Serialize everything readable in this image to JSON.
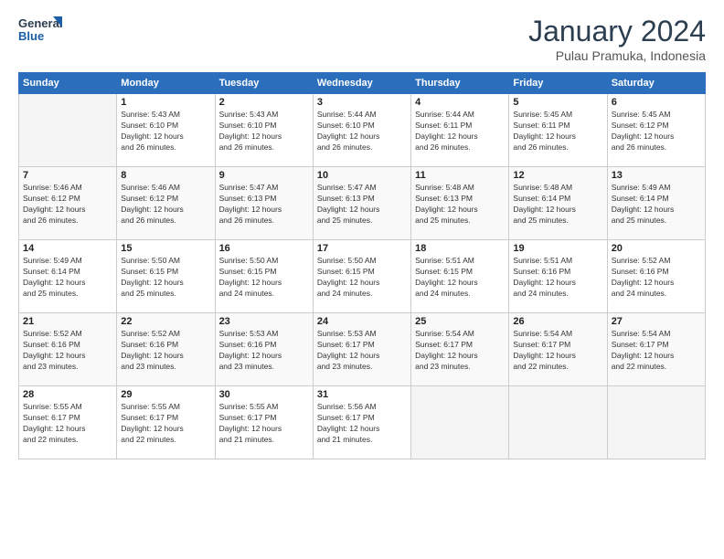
{
  "header": {
    "logo_line1": "General",
    "logo_line2": "Blue",
    "title": "January 2024",
    "subtitle": "Pulau Pramuka, Indonesia"
  },
  "weekdays": [
    "Sunday",
    "Monday",
    "Tuesday",
    "Wednesday",
    "Thursday",
    "Friday",
    "Saturday"
  ],
  "weeks": [
    [
      {
        "day": "",
        "sunrise": "",
        "sunset": "",
        "daylight": ""
      },
      {
        "day": "1",
        "sunrise": "Sunrise: 5:43 AM",
        "sunset": "Sunset: 6:10 PM",
        "daylight": "Daylight: 12 hours and 26 minutes."
      },
      {
        "day": "2",
        "sunrise": "Sunrise: 5:43 AM",
        "sunset": "Sunset: 6:10 PM",
        "daylight": "Daylight: 12 hours and 26 minutes."
      },
      {
        "day": "3",
        "sunrise": "Sunrise: 5:44 AM",
        "sunset": "Sunset: 6:10 PM",
        "daylight": "Daylight: 12 hours and 26 minutes."
      },
      {
        "day": "4",
        "sunrise": "Sunrise: 5:44 AM",
        "sunset": "Sunset: 6:11 PM",
        "daylight": "Daylight: 12 hours and 26 minutes."
      },
      {
        "day": "5",
        "sunrise": "Sunrise: 5:45 AM",
        "sunset": "Sunset: 6:11 PM",
        "daylight": "Daylight: 12 hours and 26 minutes."
      },
      {
        "day": "6",
        "sunrise": "Sunrise: 5:45 AM",
        "sunset": "Sunset: 6:12 PM",
        "daylight": "Daylight: 12 hours and 26 minutes."
      }
    ],
    [
      {
        "day": "7",
        "sunrise": "Sunrise: 5:46 AM",
        "sunset": "Sunset: 6:12 PM",
        "daylight": "Daylight: 12 hours and 26 minutes."
      },
      {
        "day": "8",
        "sunrise": "Sunrise: 5:46 AM",
        "sunset": "Sunset: 6:12 PM",
        "daylight": "Daylight: 12 hours and 26 minutes."
      },
      {
        "day": "9",
        "sunrise": "Sunrise: 5:47 AM",
        "sunset": "Sunset: 6:13 PM",
        "daylight": "Daylight: 12 hours and 26 minutes."
      },
      {
        "day": "10",
        "sunrise": "Sunrise: 5:47 AM",
        "sunset": "Sunset: 6:13 PM",
        "daylight": "Daylight: 12 hours and 25 minutes."
      },
      {
        "day": "11",
        "sunrise": "Sunrise: 5:48 AM",
        "sunset": "Sunset: 6:13 PM",
        "daylight": "Daylight: 12 hours and 25 minutes."
      },
      {
        "day": "12",
        "sunrise": "Sunrise: 5:48 AM",
        "sunset": "Sunset: 6:14 PM",
        "daylight": "Daylight: 12 hours and 25 minutes."
      },
      {
        "day": "13",
        "sunrise": "Sunrise: 5:49 AM",
        "sunset": "Sunset: 6:14 PM",
        "daylight": "Daylight: 12 hours and 25 minutes."
      }
    ],
    [
      {
        "day": "14",
        "sunrise": "Sunrise: 5:49 AM",
        "sunset": "Sunset: 6:14 PM",
        "daylight": "Daylight: 12 hours and 25 minutes."
      },
      {
        "day": "15",
        "sunrise": "Sunrise: 5:50 AM",
        "sunset": "Sunset: 6:15 PM",
        "daylight": "Daylight: 12 hours and 25 minutes."
      },
      {
        "day": "16",
        "sunrise": "Sunrise: 5:50 AM",
        "sunset": "Sunset: 6:15 PM",
        "daylight": "Daylight: 12 hours and 24 minutes."
      },
      {
        "day": "17",
        "sunrise": "Sunrise: 5:50 AM",
        "sunset": "Sunset: 6:15 PM",
        "daylight": "Daylight: 12 hours and 24 minutes."
      },
      {
        "day": "18",
        "sunrise": "Sunrise: 5:51 AM",
        "sunset": "Sunset: 6:15 PM",
        "daylight": "Daylight: 12 hours and 24 minutes."
      },
      {
        "day": "19",
        "sunrise": "Sunrise: 5:51 AM",
        "sunset": "Sunset: 6:16 PM",
        "daylight": "Daylight: 12 hours and 24 minutes."
      },
      {
        "day": "20",
        "sunrise": "Sunrise: 5:52 AM",
        "sunset": "Sunset: 6:16 PM",
        "daylight": "Daylight: 12 hours and 24 minutes."
      }
    ],
    [
      {
        "day": "21",
        "sunrise": "Sunrise: 5:52 AM",
        "sunset": "Sunset: 6:16 PM",
        "daylight": "Daylight: 12 hours and 23 minutes."
      },
      {
        "day": "22",
        "sunrise": "Sunrise: 5:52 AM",
        "sunset": "Sunset: 6:16 PM",
        "daylight": "Daylight: 12 hours and 23 minutes."
      },
      {
        "day": "23",
        "sunrise": "Sunrise: 5:53 AM",
        "sunset": "Sunset: 6:16 PM",
        "daylight": "Daylight: 12 hours and 23 minutes."
      },
      {
        "day": "24",
        "sunrise": "Sunrise: 5:53 AM",
        "sunset": "Sunset: 6:17 PM",
        "daylight": "Daylight: 12 hours and 23 minutes."
      },
      {
        "day": "25",
        "sunrise": "Sunrise: 5:54 AM",
        "sunset": "Sunset: 6:17 PM",
        "daylight": "Daylight: 12 hours and 23 minutes."
      },
      {
        "day": "26",
        "sunrise": "Sunrise: 5:54 AM",
        "sunset": "Sunset: 6:17 PM",
        "daylight": "Daylight: 12 hours and 22 minutes."
      },
      {
        "day": "27",
        "sunrise": "Sunrise: 5:54 AM",
        "sunset": "Sunset: 6:17 PM",
        "daylight": "Daylight: 12 hours and 22 minutes."
      }
    ],
    [
      {
        "day": "28",
        "sunrise": "Sunrise: 5:55 AM",
        "sunset": "Sunset: 6:17 PM",
        "daylight": "Daylight: 12 hours and 22 minutes."
      },
      {
        "day": "29",
        "sunrise": "Sunrise: 5:55 AM",
        "sunset": "Sunset: 6:17 PM",
        "daylight": "Daylight: 12 hours and 22 minutes."
      },
      {
        "day": "30",
        "sunrise": "Sunrise: 5:55 AM",
        "sunset": "Sunset: 6:17 PM",
        "daylight": "Daylight: 12 hours and 21 minutes."
      },
      {
        "day": "31",
        "sunrise": "Sunrise: 5:56 AM",
        "sunset": "Sunset: 6:17 PM",
        "daylight": "Daylight: 12 hours and 21 minutes."
      },
      {
        "day": "",
        "sunrise": "",
        "sunset": "",
        "daylight": ""
      },
      {
        "day": "",
        "sunrise": "",
        "sunset": "",
        "daylight": ""
      },
      {
        "day": "",
        "sunrise": "",
        "sunset": "",
        "daylight": ""
      }
    ]
  ]
}
